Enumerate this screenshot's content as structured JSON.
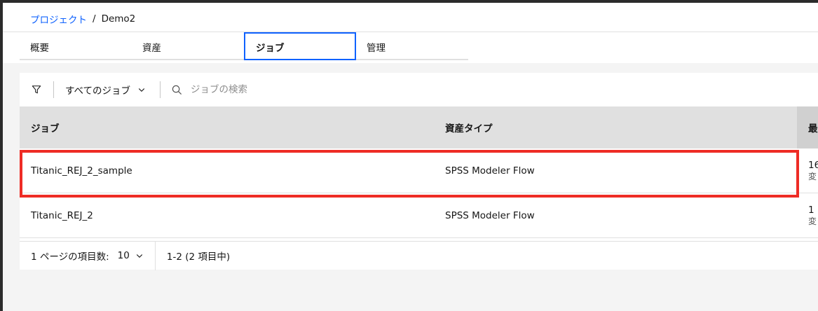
{
  "breadcrumb": {
    "root": "プロジェクト",
    "separator": "/",
    "current": "Demo2"
  },
  "tabs": [
    {
      "label": "概要"
    },
    {
      "label": "資産"
    },
    {
      "label": "ジョブ"
    },
    {
      "label": "管理"
    }
  ],
  "toolbar": {
    "filter_icon": "filter-icon",
    "dropdown_label": "すべてのジョブ",
    "search_placeholder": "ジョブの検索"
  },
  "table": {
    "headers": {
      "job": "ジョブ",
      "asset_type": "資産タイプ",
      "last": "最"
    },
    "rows": [
      {
        "job": "Titanic_REJ_2_sample",
        "asset_type": "SPSS Modeler Flow",
        "last": "16",
        "last_sub": "変"
      },
      {
        "job": "Titanic_REJ_2",
        "asset_type": "SPSS Modeler Flow",
        "last": "1",
        "last_sub": "変"
      }
    ]
  },
  "pagination": {
    "items_per_page_label": "1 ページの項目数:",
    "items_per_page_value": "10",
    "range": "1-2 (2 項目中)"
  },
  "colors": {
    "accent": "#0f62fe",
    "highlight": "#ee2c25"
  }
}
